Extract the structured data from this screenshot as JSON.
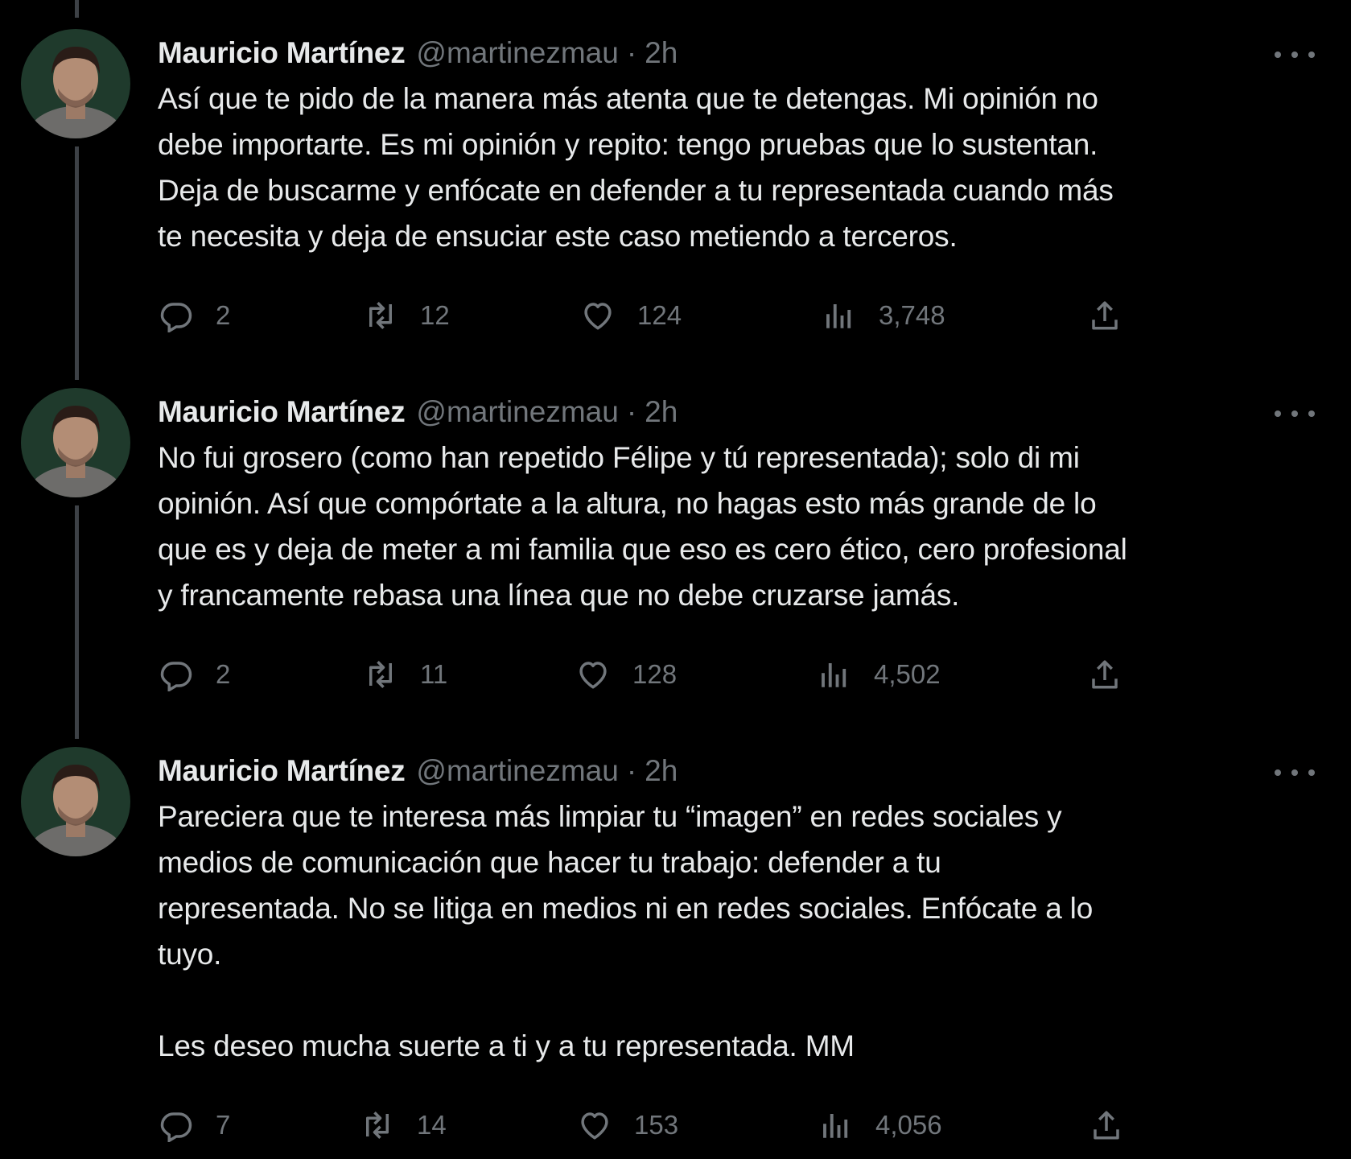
{
  "tweets": [
    {
      "author": {
        "name": "Mauricio Martínez",
        "handle": "@martinezmau",
        "separator": "·",
        "time": "2h"
      },
      "text": "Así que te pido de la manera más atenta que te detengas. Mi opinión no\ndebe importarte. Es mi opinión y repito: tengo pruebas que lo sustentan.\nDeja de buscarme y enfócate en defender a tu representada cuando más\nte necesita y deja de ensuciar este caso metiendo a terceros.",
      "replies": "2",
      "retweets": "12",
      "likes": "124",
      "views": "3,748"
    },
    {
      "author": {
        "name": "Mauricio Martínez",
        "handle": "@martinezmau",
        "separator": "·",
        "time": "2h"
      },
      "text": "No fui grosero (como han repetido Félipe y tú representada); solo di mi\nopinión. Así que compórtate a la altura, no hagas esto más grande de lo\nque es y deja de meter a mi familia que eso es cero ético, cero profesional\ny francamente rebasa una línea que no debe cruzarse jamás.",
      "replies": "2",
      "retweets": "11",
      "likes": "128",
      "views": "4,502"
    },
    {
      "author": {
        "name": "Mauricio Martínez",
        "handle": "@martinezmau",
        "separator": "·",
        "time": "2h"
      },
      "text": "Pareciera que te interesa más limpiar tu “imagen” en redes sociales y\nmedios de comunicación que hacer tu trabajo: defender a tu\nrepresentada. No se litiga en medios ni en redes sociales. Enfócate a lo\ntuyo.\n\nLes deseo mucha suerte a ti y a tu representada. MM",
      "replies": "7",
      "retweets": "14",
      "likes": "153",
      "views": "4,056"
    }
  ],
  "icons": {
    "reply": "reply-icon",
    "retweet": "retweet-icon",
    "like": "like-icon",
    "views": "views-icon",
    "share": "share-icon",
    "more": "more-icon"
  },
  "colors": {
    "background": "#000000",
    "text": "#e7e9ea",
    "secondary": "#71767b",
    "thread_line": "#3d4146"
  }
}
